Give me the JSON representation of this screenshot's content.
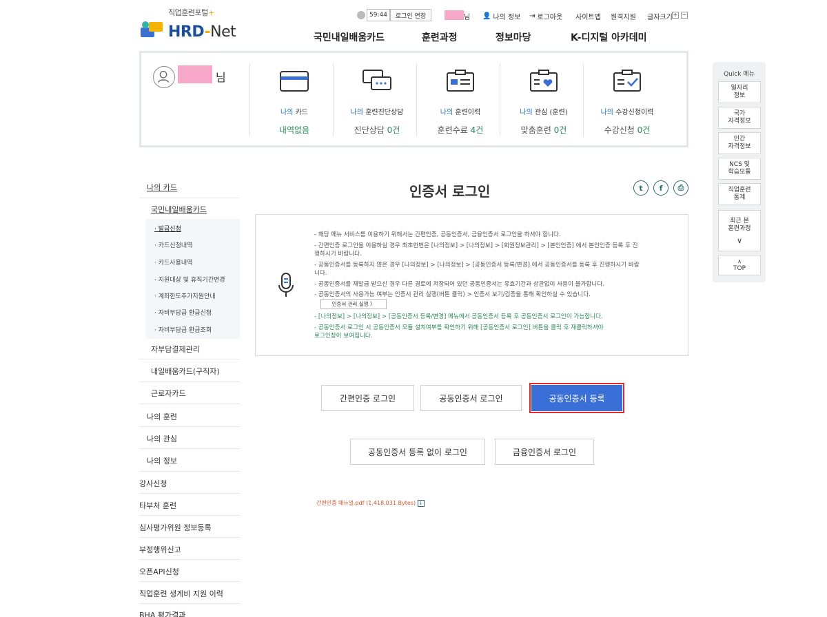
{
  "header": {
    "logo_small": "직업훈련포털",
    "logo_main": "HRD",
    "logo_net": "Net",
    "timer": "59:44",
    "extend_login": "로그인 연장",
    "user_suffix": "님",
    "my_info": "나의 정보",
    "logout": "로그아웃",
    "sitemap": "사이트맵",
    "remote_support": "원격지원",
    "font_size": "글자크기",
    "font_plus": "+",
    "font_minus": "−",
    "nav": [
      "국민내일배움카드",
      "훈련과정",
      "정보마당",
      "K-디지털 아카데미"
    ]
  },
  "user_panel": {
    "name_suffix": "님",
    "cards": [
      {
        "pre": "나의",
        "label": "카드",
        "value": "내역없음",
        "icon": "card-icon"
      },
      {
        "pre": "나의",
        "label": "훈련진단상담",
        "value_pre": "진단상담",
        "value": "0건",
        "icon": "consult-icon"
      },
      {
        "pre": "나의",
        "label": "훈련이력",
        "value_pre": "훈련수료",
        "value": "4건",
        "icon": "history-icon"
      },
      {
        "pre": "나의",
        "label": "관심 (훈련)",
        "value_pre": "맞춤훈련",
        "value": "0건",
        "icon": "heart-icon"
      },
      {
        "pre": "나의",
        "label": "수강신청이력",
        "value_pre": "수강신청",
        "value": "0건",
        "icon": "check-icon"
      }
    ]
  },
  "left_menu": {
    "my_card": "나의 카드",
    "national_card": "국민내일배움카드",
    "sub_items": [
      "발급신청",
      "카드신청내역",
      "카드사용내역",
      "지원대상 및 휴직기간변경",
      "계좌한도추가지원안내",
      "자비부담급 환급신청",
      "자비부담급 환급조회"
    ],
    "items2": [
      "자부담결제관리",
      "내일배움카드(구직자)",
      "근로자카드"
    ],
    "items3": [
      "나의 훈련",
      "나의 관심",
      "나의 정보",
      "강사신청",
      "타부처 훈련",
      "심사평가위원 정보등록",
      "부정행위신고",
      "오픈API신청",
      "직업훈련 생계비 지원 이력",
      "BHA 평가결과"
    ]
  },
  "page": {
    "title": "인증서 로그인",
    "notices": [
      "- 해당 메뉴 서비스를 이용하기 위해서는 간편인증, 공동인증서, 금융인증서 로그인을 하셔야 합니다.",
      "- 간편인증 로그인을 이용하실 경우 최초한번은 [나의정보] > [나의정보] > [회원정보관리] > [본인인증] 에서 본인인증 등록 후 진",
      "  행하시기 바랍니다.",
      "- 공동인증서를 등록하지 않은 경우 [나의정보] > [나의정보] > [공동인증서 등록/변경] 에서 공동인증서를 등록 후 진행하시기 바랍",
      "  니다.",
      "- 공동인증서를 재발급 받으신 경우 다른 경로에 저장되어 있던 공동인증서는 유효기간과 상관없이 사용이 불가합니다.",
      "- 공동인증서의 사용가능 여부는 인증서 관리 실행(버튼 클릭) > 인증서 보기/검증을 통해 확인하실 수 있습니다."
    ],
    "cert_manager_btn": "인증서 관리 실행 〉",
    "green_notices": [
      "- [나의정보] > [나의정보] > [공동인증서 등록/변경] 메뉴에서 공동인증서 등록 후 공동인증서 로그인이 가능합니다.",
      "- 공동인증서 로그인 시 공동인증서 모듈 설치여부를 확인하기 위해 [공동인증서 로그인] 버튼을 클릭 후 재클릭하셔야",
      "  로그인창이 보여집니다."
    ],
    "btn_simple": "간편인증 로그인",
    "btn_joint": "공동인증서 로그인",
    "btn_register": "공동인증서 등록",
    "btn_no_register": "공동인증서 등록 없이 로그인",
    "btn_financial": "금융인증서 로그인",
    "pdf_link": "간편인증 매뉴얼.pdf (1,418,031 Bytes)"
  },
  "quick": {
    "title": "Quick 메뉴",
    "items": [
      "일자리\n정보",
      "국가\n자격정보",
      "민간\n자격정보",
      "NCS 및\n학습모듈",
      "직업훈련\n통계",
      "최근 본\n훈련과정"
    ],
    "top": "TOP"
  },
  "colors": {
    "accent": "#3a6fd8",
    "green": "#2a8a57",
    "blue_label": "#1f6fce",
    "highlight": "#e12b2b"
  }
}
